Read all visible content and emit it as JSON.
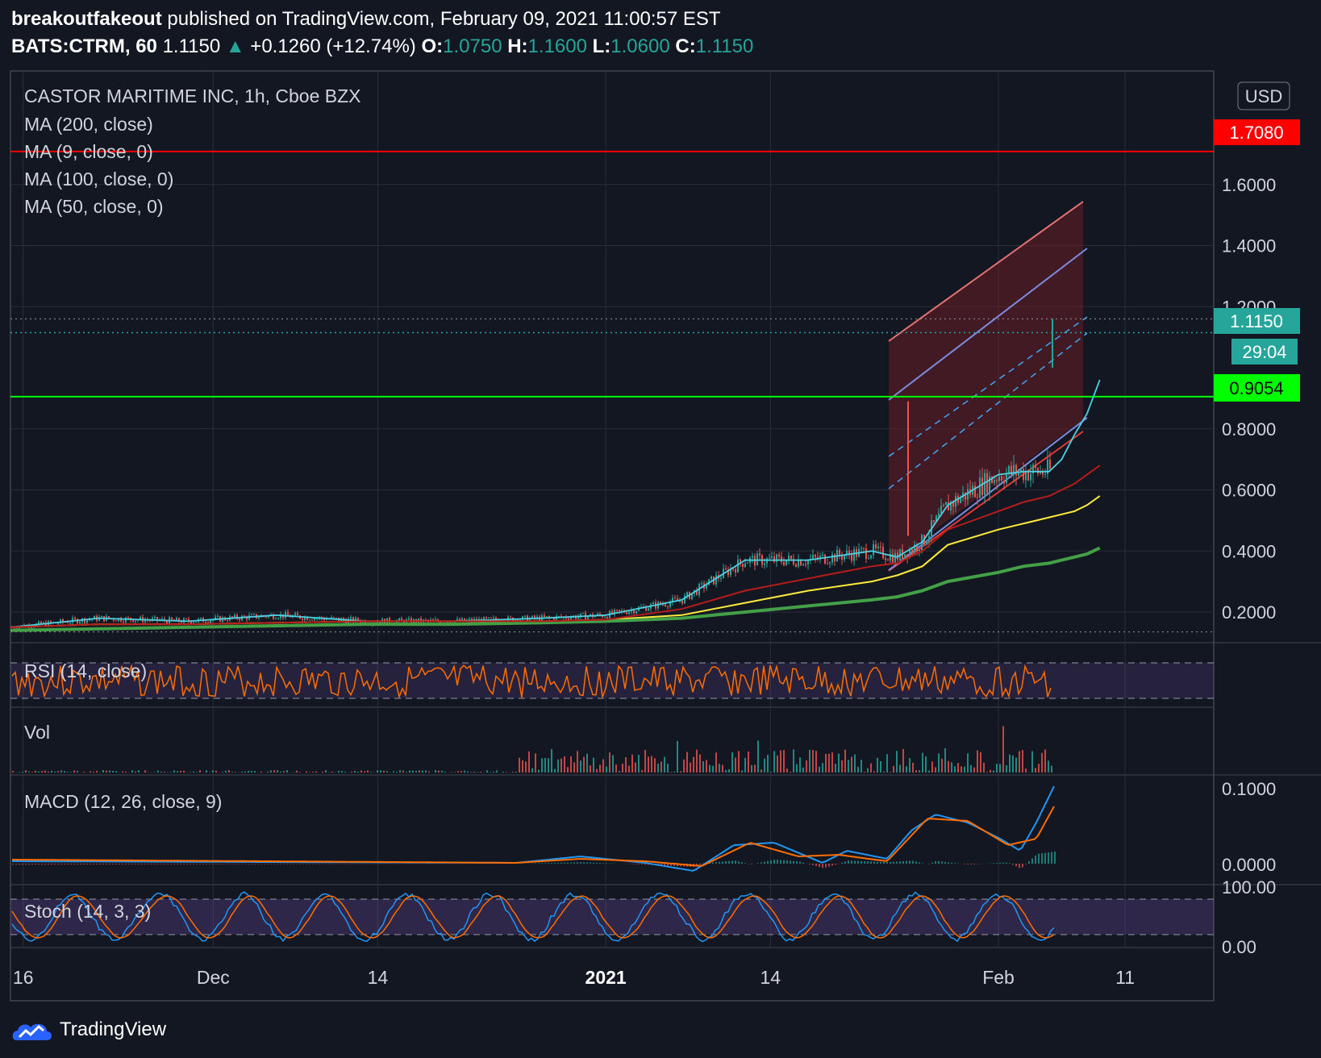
{
  "header": {
    "author": "breakoutfakeout",
    "published_text": "published on TradingView.com, February 09, 2021 11:00:57 EST",
    "symbol": "BATS:CTRM, 60",
    "last": "1.1150",
    "change": "+0.1260 (+12.74%)",
    "o_label": "O:",
    "o": "1.0750",
    "h_label": "H:",
    "h": "1.1600",
    "l_label": "L:",
    "l": "1.0600",
    "c_label": "C:",
    "c": "1.1150"
  },
  "legend": {
    "title": "CASTOR MARITIME INC, 1h, Cboe BZX",
    "ma200": "MA (200, close)",
    "ma9": "MA (9, close, 0)",
    "ma100": "MA (100, close, 0)",
    "ma50": "MA (50, close, 0)"
  },
  "currency": "USD",
  "brand": "TradingView",
  "pane_labels": {
    "rsi": "RSI (14, close)",
    "vol": "Vol",
    "macd": "MACD (12, 26, close, 9)",
    "stoch": "Stoch (14, 3, 3)"
  },
  "price_badges": {
    "resistance": "1.7080",
    "last": "1.1150",
    "countdown": "29:04",
    "support": "0.9054"
  },
  "colors": {
    "background": "#131722",
    "up": "#26a69a",
    "down": "#ef5350",
    "resistance": "#ff0000",
    "support": "#00ff00",
    "ma9": "#4dd0e1",
    "ma50": "#ffeb3b",
    "ma100": "#43a047",
    "ma200": "#b71c1c",
    "rsi": "#ff6d00",
    "macd": "#2196f3",
    "signal": "#ff6d00"
  },
  "chart_data": {
    "type": "line",
    "title": "CASTOR MARITIME INC, 1h, Cboe BZX",
    "x_ticks": [
      "16",
      "Dec",
      "14",
      "2021",
      "14",
      "Feb",
      "11"
    ],
    "y_ticks": [
      "0.2000",
      "0.4000",
      "0.6000",
      "0.8000",
      "1.2000",
      "1.4000",
      "1.6000"
    ],
    "ylim": [
      0.13,
      1.82
    ],
    "x_range": [
      "2020-11-15",
      "2021-02-18"
    ],
    "grid": true,
    "x": [
      "2020-11-15",
      "2020-11-22",
      "2020-11-29",
      "2020-12-06",
      "2020-12-13",
      "2020-12-20",
      "2020-12-27",
      "2021-01-01",
      "2021-01-07",
      "2021-01-12",
      "2021-01-17",
      "2021-01-22",
      "2021-01-24",
      "2021-01-26",
      "2021-01-28",
      "2021-02-01",
      "2021-02-03",
      "2021-02-05",
      "2021-02-06",
      "2021-02-07",
      "2021-02-08",
      "2021-02-09"
    ],
    "series": [
      {
        "name": "MA (9, close, 0)",
        "values": [
          0.15,
          0.18,
          0.17,
          0.19,
          0.17,
          0.17,
          0.18,
          0.19,
          0.24,
          0.37,
          0.37,
          0.4,
          0.38,
          0.43,
          0.55,
          0.65,
          0.66,
          0.66,
          0.7,
          0.78,
          0.85,
          0.96
        ]
      },
      {
        "name": "MA (50, close, 0)",
        "values": [
          0.15,
          0.16,
          0.16,
          0.165,
          0.17,
          0.17,
          0.17,
          0.175,
          0.19,
          0.23,
          0.27,
          0.3,
          0.32,
          0.35,
          0.42,
          0.47,
          0.49,
          0.51,
          0.52,
          0.53,
          0.55,
          0.58
        ]
      },
      {
        "name": "MA (100, close, 0)",
        "values": [
          0.14,
          0.145,
          0.15,
          0.155,
          0.16,
          0.16,
          0.165,
          0.17,
          0.18,
          0.2,
          0.22,
          0.24,
          0.25,
          0.27,
          0.3,
          0.33,
          0.35,
          0.36,
          0.37,
          0.38,
          0.39,
          0.41
        ]
      },
      {
        "name": "MA (200, close)",
        "values": [
          0.15,
          0.16,
          0.16,
          0.165,
          0.17,
          0.17,
          0.17,
          0.175,
          0.21,
          0.27,
          0.31,
          0.35,
          0.36,
          0.4,
          0.47,
          0.53,
          0.56,
          0.58,
          0.6,
          0.62,
          0.65,
          0.68
        ]
      }
    ],
    "horizontal_lines": [
      {
        "value": 1.708,
        "label": "1.7080"
      },
      {
        "value": 0.9054,
        "label": "0.9054"
      }
    ],
    "last_price": 1.115,
    "annotations": [
      "29:04"
    ]
  }
}
